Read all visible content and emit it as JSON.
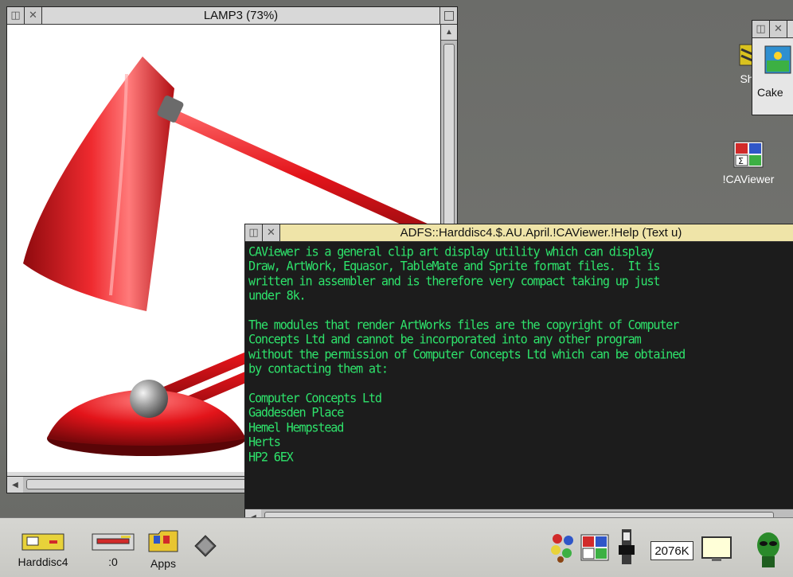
{
  "lamp_window": {
    "title": "LAMP3 (73%)"
  },
  "help_window": {
    "title": "ADFS::Harddisc4.$.AU.April.!CAViewer.!Help (Text u)",
    "lines": [
      "CAViewer is a general clip art display utility which can display",
      "Draw, ArtWork, Equasor, TableMate and Sprite format files.  It is",
      "written in assembler and is therefore very compact taking up just",
      "under 8k.",
      "",
      "The modules that render ArtWorks files are the copyright of Computer",
      "Concepts Ltd and cannot be incorporated into any other program",
      "without the permission of Computer Concepts Ltd which can be obtained",
      "by contacting them at:",
      "",
      "Computer Concepts Ltd",
      "Gaddesden Place",
      "Hemel Hempstead",
      "Herts",
      "HP2 6EX"
    ]
  },
  "cake_window": {
    "label": "Cake"
  },
  "desktop_icons": [
    {
      "name": "Sh",
      "icon": "app-icon"
    },
    {
      "name": "!CAViewer",
      "icon": "caviewer-icon"
    }
  ],
  "iconbar": {
    "left": [
      {
        "label": "Harddisc4",
        "icon": "harddisc-icon"
      },
      {
        "label": ":0",
        "icon": "floppy-icon"
      },
      {
        "label": "Apps",
        "icon": "apps-folder-icon"
      },
      {
        "label": "",
        "icon": "diamond-icon"
      }
    ],
    "memory": "2076K",
    "colors": {
      "lamp_red": "#e3141a",
      "text_green": "#2ee36b",
      "text_bg": "#1c1c1c",
      "title_focus": "#efe4a8"
    }
  }
}
